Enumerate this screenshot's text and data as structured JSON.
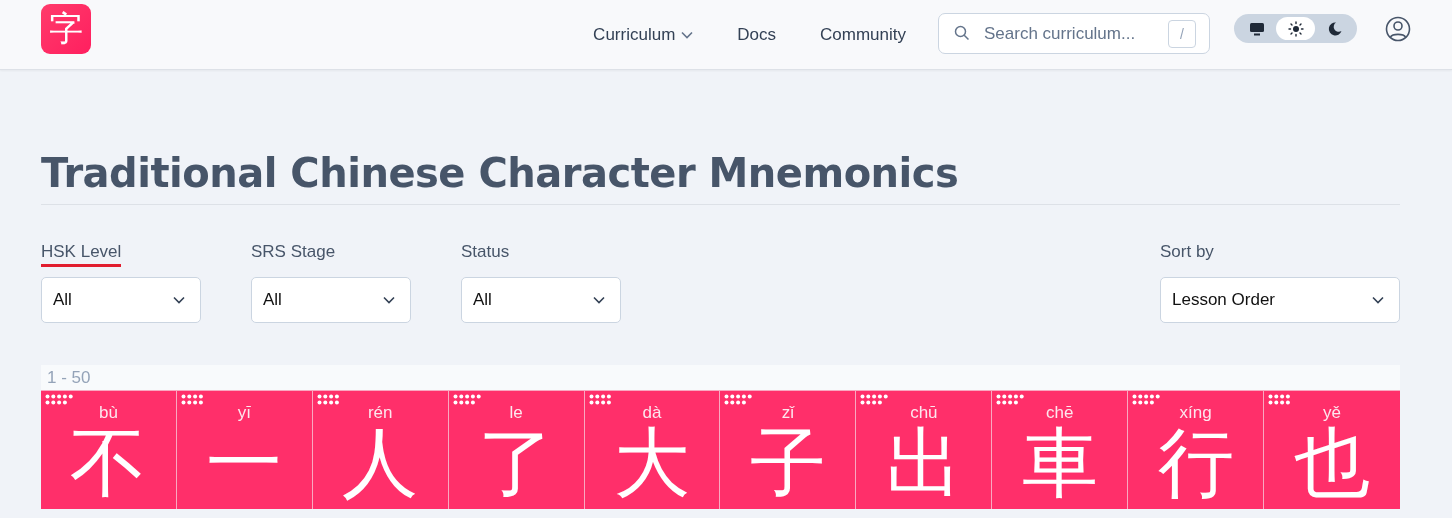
{
  "header": {
    "logo": "字",
    "nav": [
      {
        "label": "Curriculum",
        "kind": "dropdown"
      },
      {
        "label": "Docs",
        "kind": "link"
      },
      {
        "label": "Community",
        "kind": "link"
      }
    ],
    "search": {
      "placeholder": "Search curriculum...",
      "shortcut": "/"
    },
    "theme": [
      {
        "kind": "system",
        "selected": false
      },
      {
        "kind": "light",
        "selected": true
      },
      {
        "kind": "dark",
        "selected": false
      }
    ]
  },
  "title": "Traditional Chinese Character Mnemonics",
  "filters": [
    {
      "label": "HSK Level",
      "value": "All",
      "selected": true
    },
    {
      "label": "SRS Stage",
      "value": "All",
      "selected": false
    },
    {
      "label": "Status",
      "value": "All",
      "selected": false
    }
  ],
  "sort": {
    "label": "Sort by",
    "value": "Lesson Order"
  },
  "grid": {
    "range": "1 - 50",
    "cards": [
      {
        "pinyin": "bù",
        "character": "不",
        "kind": "nine"
      },
      {
        "pinyin": "yī",
        "character": "一",
        "kind": "eight"
      },
      {
        "pinyin": "rén",
        "character": "人",
        "kind": "eight"
      },
      {
        "pinyin": "le",
        "character": "了",
        "kind": "nine"
      },
      {
        "pinyin": "dà",
        "character": "大",
        "kind": "eight"
      },
      {
        "pinyin": "zǐ",
        "character": "子",
        "kind": "nine"
      },
      {
        "pinyin": "chū",
        "character": "出",
        "kind": "nine"
      },
      {
        "pinyin": "chē",
        "character": "車",
        "kind": "nine"
      },
      {
        "pinyin": "xíng",
        "character": "行",
        "kind": "nine"
      },
      {
        "pinyin": "yě",
        "character": "也",
        "kind": "eight"
      }
    ]
  }
}
